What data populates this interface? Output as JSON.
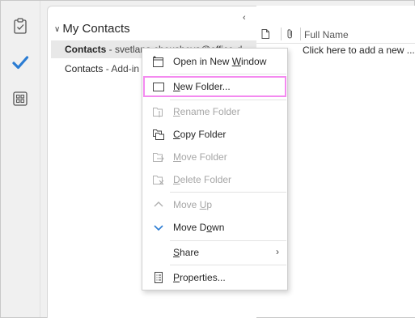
{
  "rail": {
    "icons": [
      "tasks-clipboard-icon",
      "todo-check-icon",
      "apps-grid-icon"
    ],
    "accent": "#2b7cd3"
  },
  "folders": {
    "collapse_glyph": "‹",
    "group": "My Contacts",
    "rows": [
      {
        "name": "Contacts",
        "sub": " - svetlana.cheusheva@office-d"
      },
      {
        "name": "Contacts",
        "sub": " - Add-in"
      }
    ]
  },
  "list": {
    "column": "Full Name",
    "add_prompt": "Click here to add a new ..."
  },
  "menu": {
    "highlight_color": "#f48af0",
    "items": [
      {
        "pre": "Open in New ",
        "key": "W",
        "post": "indow",
        "enabled": true,
        "icon": "open-new-window-icon"
      },
      {
        "pre": "",
        "key": "N",
        "post": "ew Folder...",
        "enabled": true,
        "icon": "new-folder-icon"
      },
      {
        "pre": "",
        "key": "R",
        "post": "ename Folder",
        "enabled": false,
        "icon": "rename-folder-icon"
      },
      {
        "pre": "",
        "key": "C",
        "post": "opy Folder",
        "enabled": true,
        "icon": "copy-folder-icon"
      },
      {
        "pre": "",
        "key": "M",
        "post": "ove Folder",
        "enabled": false,
        "icon": "move-folder-icon"
      },
      {
        "pre": "",
        "key": "D",
        "post": "elete Folder",
        "enabled": false,
        "icon": "delete-folder-icon"
      },
      {
        "pre": "Move ",
        "key": "U",
        "post": "p",
        "enabled": false,
        "icon": "chevron-up-icon"
      },
      {
        "pre": "Move D",
        "key": "o",
        "post": "wn",
        "enabled": true,
        "icon": "chevron-down-icon"
      },
      {
        "pre": "",
        "key": "S",
        "post": "hare",
        "enabled": true,
        "icon": "",
        "submenu_glyph": "›"
      },
      {
        "pre": "",
        "key": "P",
        "post": "roperties...",
        "enabled": true,
        "icon": "properties-icon"
      }
    ]
  }
}
